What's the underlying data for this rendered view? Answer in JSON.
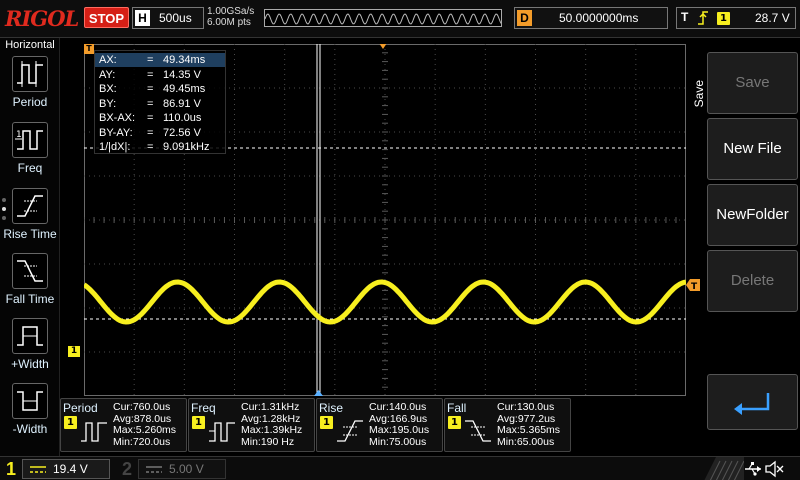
{
  "topbar": {
    "logo": "RIGOL",
    "run_state": "STOP",
    "horizontal_label": "H",
    "timebase": "500us",
    "sample_rate": "1.00GSa/s",
    "memory_depth": "6.00M pts",
    "delay_label": "D",
    "delay": "50.0000000ms",
    "trigger_label": "T",
    "trigger_channel": "1",
    "trigger_level": "28.7 V"
  },
  "left_panel": {
    "title": "Horizontal",
    "items": [
      {
        "label": "Period",
        "icon": "period-icon"
      },
      {
        "label": "Freq",
        "icon": "freq-icon"
      },
      {
        "label": "Rise Time",
        "icon": "rise-time-icon"
      },
      {
        "label": "Fall Time",
        "icon": "fall-time-icon"
      },
      {
        "label": "+Width",
        "icon": "pos-width-icon"
      },
      {
        "label": "-Width",
        "icon": "neg-width-icon"
      }
    ]
  },
  "cursor_readout": [
    {
      "label": "AX:",
      "value": "49.34ms"
    },
    {
      "label": "AY:",
      "value": "14.35 V"
    },
    {
      "label": "BX:",
      "value": "49.45ms"
    },
    {
      "label": "BY:",
      "value": "86.91 V"
    },
    {
      "label": "BX-AX:",
      "value": "110.0us"
    },
    {
      "label": "BY-AY:",
      "value": "72.56 V"
    },
    {
      "label": "1/|dX|:",
      "value": "9.091kHz"
    }
  ],
  "channel1_marker": "1",
  "right_panel": {
    "title": "Save",
    "buttons": [
      {
        "label": "Save",
        "enabled": false
      },
      {
        "label": "New File",
        "enabled": true
      },
      {
        "label": "NewFolder",
        "enabled": true
      },
      {
        "label": "Delete",
        "enabled": false
      }
    ],
    "back_icon": "return-arrow-icon"
  },
  "measurements": [
    {
      "name": "Period",
      "channel": "1",
      "icon": "period-icon",
      "cur": "Cur:760.0us",
      "avg": "Avg:878.0us",
      "max": "Max:5.260ms",
      "min": "Min:720.0us"
    },
    {
      "name": "Freq",
      "channel": "1",
      "icon": "freq-icon",
      "cur": "Cur:1.31kHz",
      "avg": "Avg:1.28kHz",
      "max": "Max:1.39kHz",
      "min": "Min:190 Hz"
    },
    {
      "name": "Rise",
      "channel": "1",
      "icon": "rise-time-icon",
      "cur": "Cur:140.0us",
      "avg": "Avg:166.9us",
      "max": "Max:195.0us",
      "min": "Min:75.00us"
    },
    {
      "name": "Fall",
      "channel": "1",
      "icon": "fall-time-icon",
      "cur": "Cur:130.0us",
      "avg": "Avg:977.2us",
      "max": "Max:5.365ms",
      "min": "Min:65.00us"
    }
  ],
  "bottombar": {
    "ch1_label": "1",
    "ch1_scale": "19.4 V",
    "ch2_label": "2",
    "ch2_scale": "5.00 V",
    "icons": [
      "usb-icon",
      "speaker-muted-icon"
    ]
  },
  "colors": {
    "ch1": "#f7ef1f",
    "stop": "#d51f16",
    "trigger": "#f39c2a",
    "cursor_box": "#1f3f5f"
  }
}
